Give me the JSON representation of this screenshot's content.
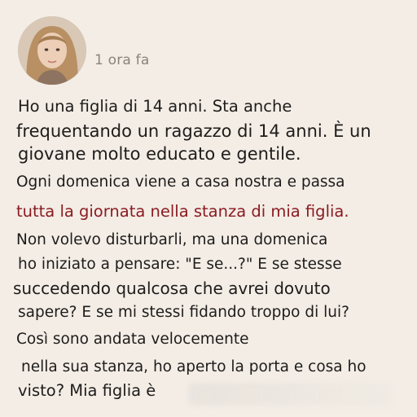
{
  "post": {
    "timestamp": "1 ora fa",
    "lines": [
      "Ho una figlia di 14 anni. Sta anche",
      "frequentando un ragazzo di 14 anni. È un",
      "giovane molto educato e gentile.",
      "Ogni domenica viene a casa nostra e passa",
      "tutta la giornata nella stanza di mia figlia.",
      "Non volevo disturbarli, ma una domenica",
      "ho iniziato a pensare: \"E se...?\" E se stesse",
      "succedendo qualcosa che avrei dovuto",
      "sapere? E se mi stessi fidando troppo di lui?",
      "Così sono andata velocemente",
      "nella sua stanza, ho aperto la porta e cosa ho",
      "visto? Mia figlia è"
    ]
  },
  "colors": {
    "background": "#f3ede6",
    "text": "#1e1c1a",
    "highlight_text": "#8b1c22",
    "timestamp": "#8a837c"
  }
}
